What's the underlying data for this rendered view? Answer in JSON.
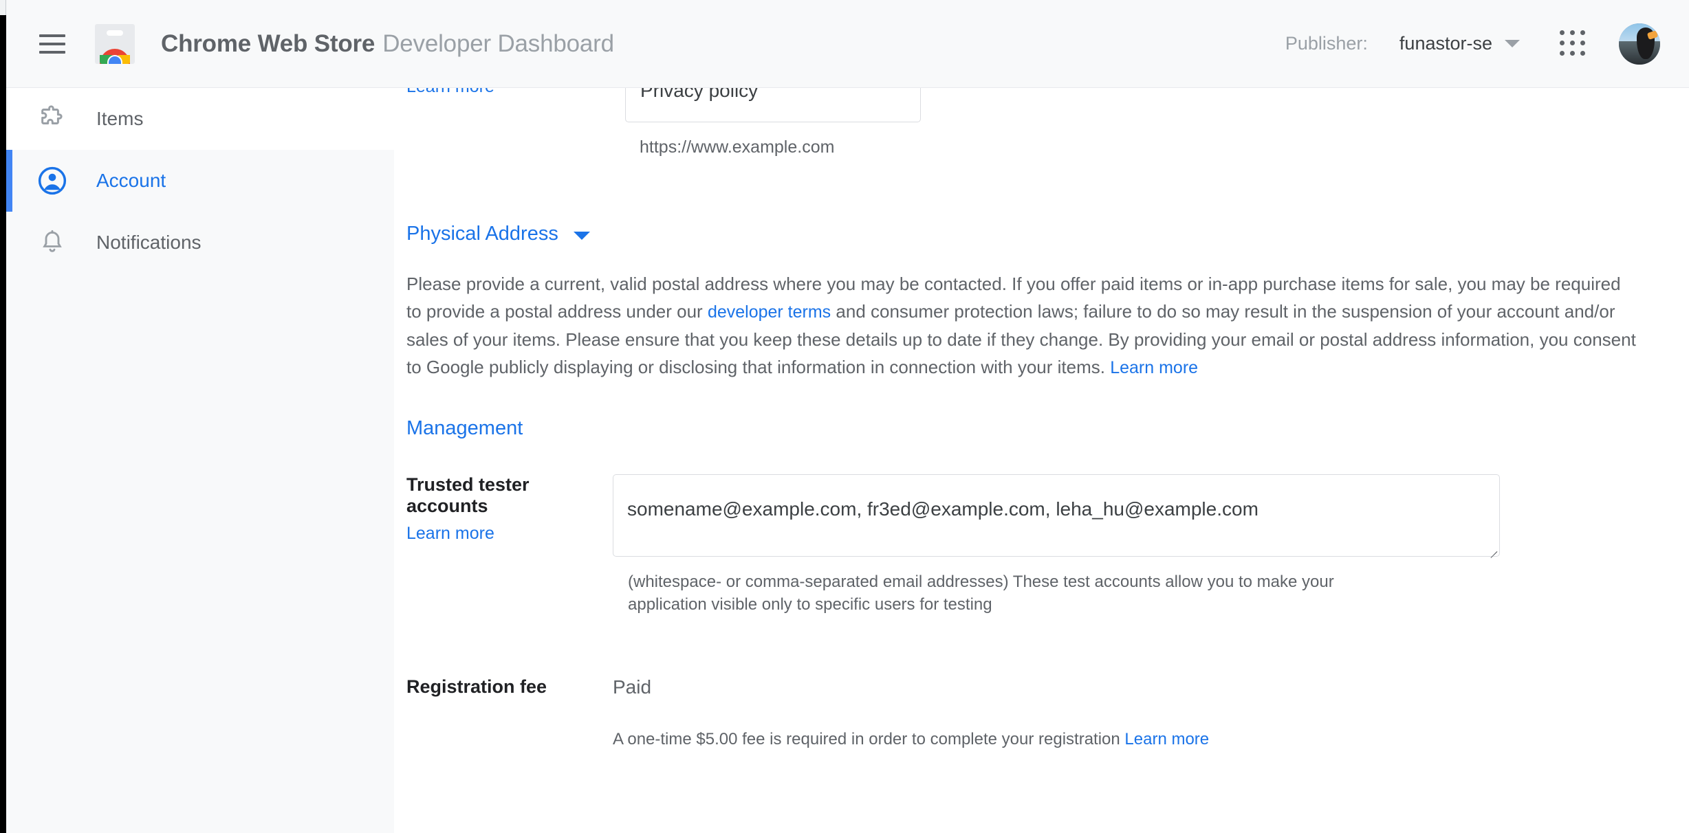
{
  "header": {
    "menu_icon": "hamburger-menu-icon",
    "logo_icon": "chrome-web-store-logo",
    "title_strong": "Chrome Web Store",
    "title_light": "Developer Dashboard",
    "publisher_label": "Publisher:",
    "publisher_value": "funastor-se",
    "publisher_caret_icon": "chevron-down-icon",
    "apps_icon": "google-apps-grid-icon",
    "avatar_icon": "user-avatar"
  },
  "sidebar": {
    "items": [
      {
        "label": "Items",
        "icon": "puzzle-piece-icon",
        "active": false,
        "hovered": true
      },
      {
        "label": "Account",
        "icon": "account-circle-icon",
        "active": true,
        "hovered": false
      },
      {
        "label": "Notifications",
        "icon": "bell-icon",
        "active": false,
        "hovered": false
      }
    ]
  },
  "main": {
    "privacy": {
      "learn_more": "Learn more",
      "field_value": "Privacy policy",
      "hint": "https://www.example.com"
    },
    "physical_address": {
      "heading": "Physical Address",
      "caret_icon": "chevron-down-icon",
      "paragraph_part1": "Please provide a current, valid postal address where you may be contacted. If you offer paid items or in-app purchase items for sale, you may be required to provide a postal address under our ",
      "developer_terms_link": "developer terms",
      "paragraph_part2": " and consumer protection laws; failure to do so may result in the suspension of your account and/or sales of your items. Please ensure that you keep these details up to date if they change. By providing your email or postal address information, you consent to Google publicly displaying or disclosing that information in connection with your items. ",
      "learn_more": "Learn more"
    },
    "management": {
      "heading": "Management",
      "trusted_tester": {
        "label": "Trusted tester accounts",
        "learn_more": "Learn more",
        "value": "somename@example.com, fr3ed@example.com, leha_hu@example.com",
        "placeholder": "",
        "helper": "(whitespace- or comma-separated email addresses) These test accounts allow you to make your application visible only to specific users for testing"
      },
      "registration_fee": {
        "label": "Registration fee",
        "value": "Paid",
        "note": "A one-time $5.00 fee is required in order to complete your registration ",
        "learn_more": "Learn more"
      }
    }
  },
  "colors": {
    "accent_blue": "#1a73e8",
    "active_bar": "#4285f4",
    "text_primary": "#202124",
    "text_secondary": "#5f6368",
    "sidebar_bg": "#f8f9fa",
    "header_bg": "#f8f9fa",
    "border": "#dadce0"
  }
}
